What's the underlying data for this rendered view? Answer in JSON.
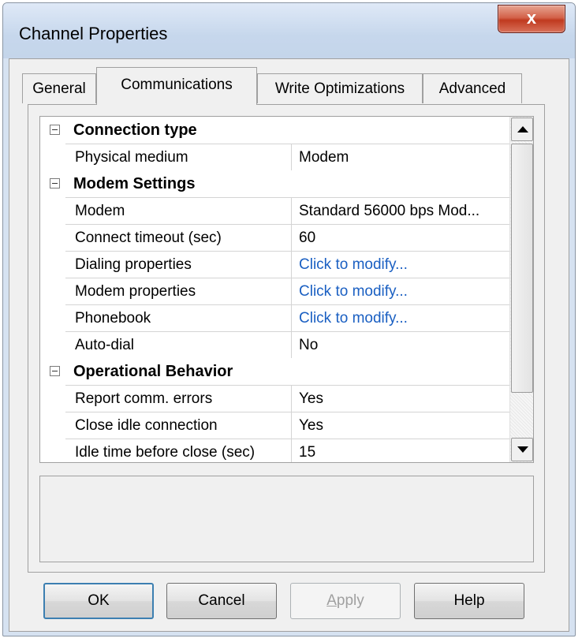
{
  "window": {
    "title": "Channel Properties",
    "close_glyph": "x"
  },
  "tabs": [
    {
      "label": "General",
      "active": false
    },
    {
      "label": "Communications",
      "active": true
    },
    {
      "label": "Write Optimizations",
      "active": false
    },
    {
      "label": "Advanced",
      "active": false
    }
  ],
  "property_grid": {
    "sections": [
      {
        "label": "Connection type",
        "rows": [
          {
            "name": "Physical medium",
            "value": "Modem",
            "link": false
          }
        ]
      },
      {
        "label": "Modem Settings",
        "rows": [
          {
            "name": "Modem",
            "value": "Standard 56000 bps Mod...",
            "link": false
          },
          {
            "name": "Connect timeout (sec)",
            "value": "60",
            "link": false
          },
          {
            "name": "Dialing properties",
            "value": "Click to modify...",
            "link": true
          },
          {
            "name": "Modem properties",
            "value": "Click to modify...",
            "link": true
          },
          {
            "name": "Phonebook",
            "value": "Click to modify...",
            "link": true
          },
          {
            "name": "Auto-dial",
            "value": "No",
            "link": false
          }
        ]
      },
      {
        "label": "Operational Behavior",
        "rows": [
          {
            "name": "Report comm. errors",
            "value": "Yes",
            "link": false
          },
          {
            "name": "Close idle connection",
            "value": "Yes",
            "link": false
          },
          {
            "name": "Idle time before close (sec)",
            "value": "15",
            "link": false
          }
        ]
      }
    ]
  },
  "buttons": {
    "ok": "OK",
    "cancel": "Cancel",
    "apply_prefix": "",
    "apply_mnemonic": "A",
    "apply_rest": "pply",
    "help": "Help"
  },
  "colors": {
    "link": "#1a5fc2",
    "close_button": "#c03a1f"
  },
  "icons": [
    "close-icon",
    "collapse-icon",
    "scroll-up-arrow-icon",
    "scroll-down-arrow-icon"
  ]
}
